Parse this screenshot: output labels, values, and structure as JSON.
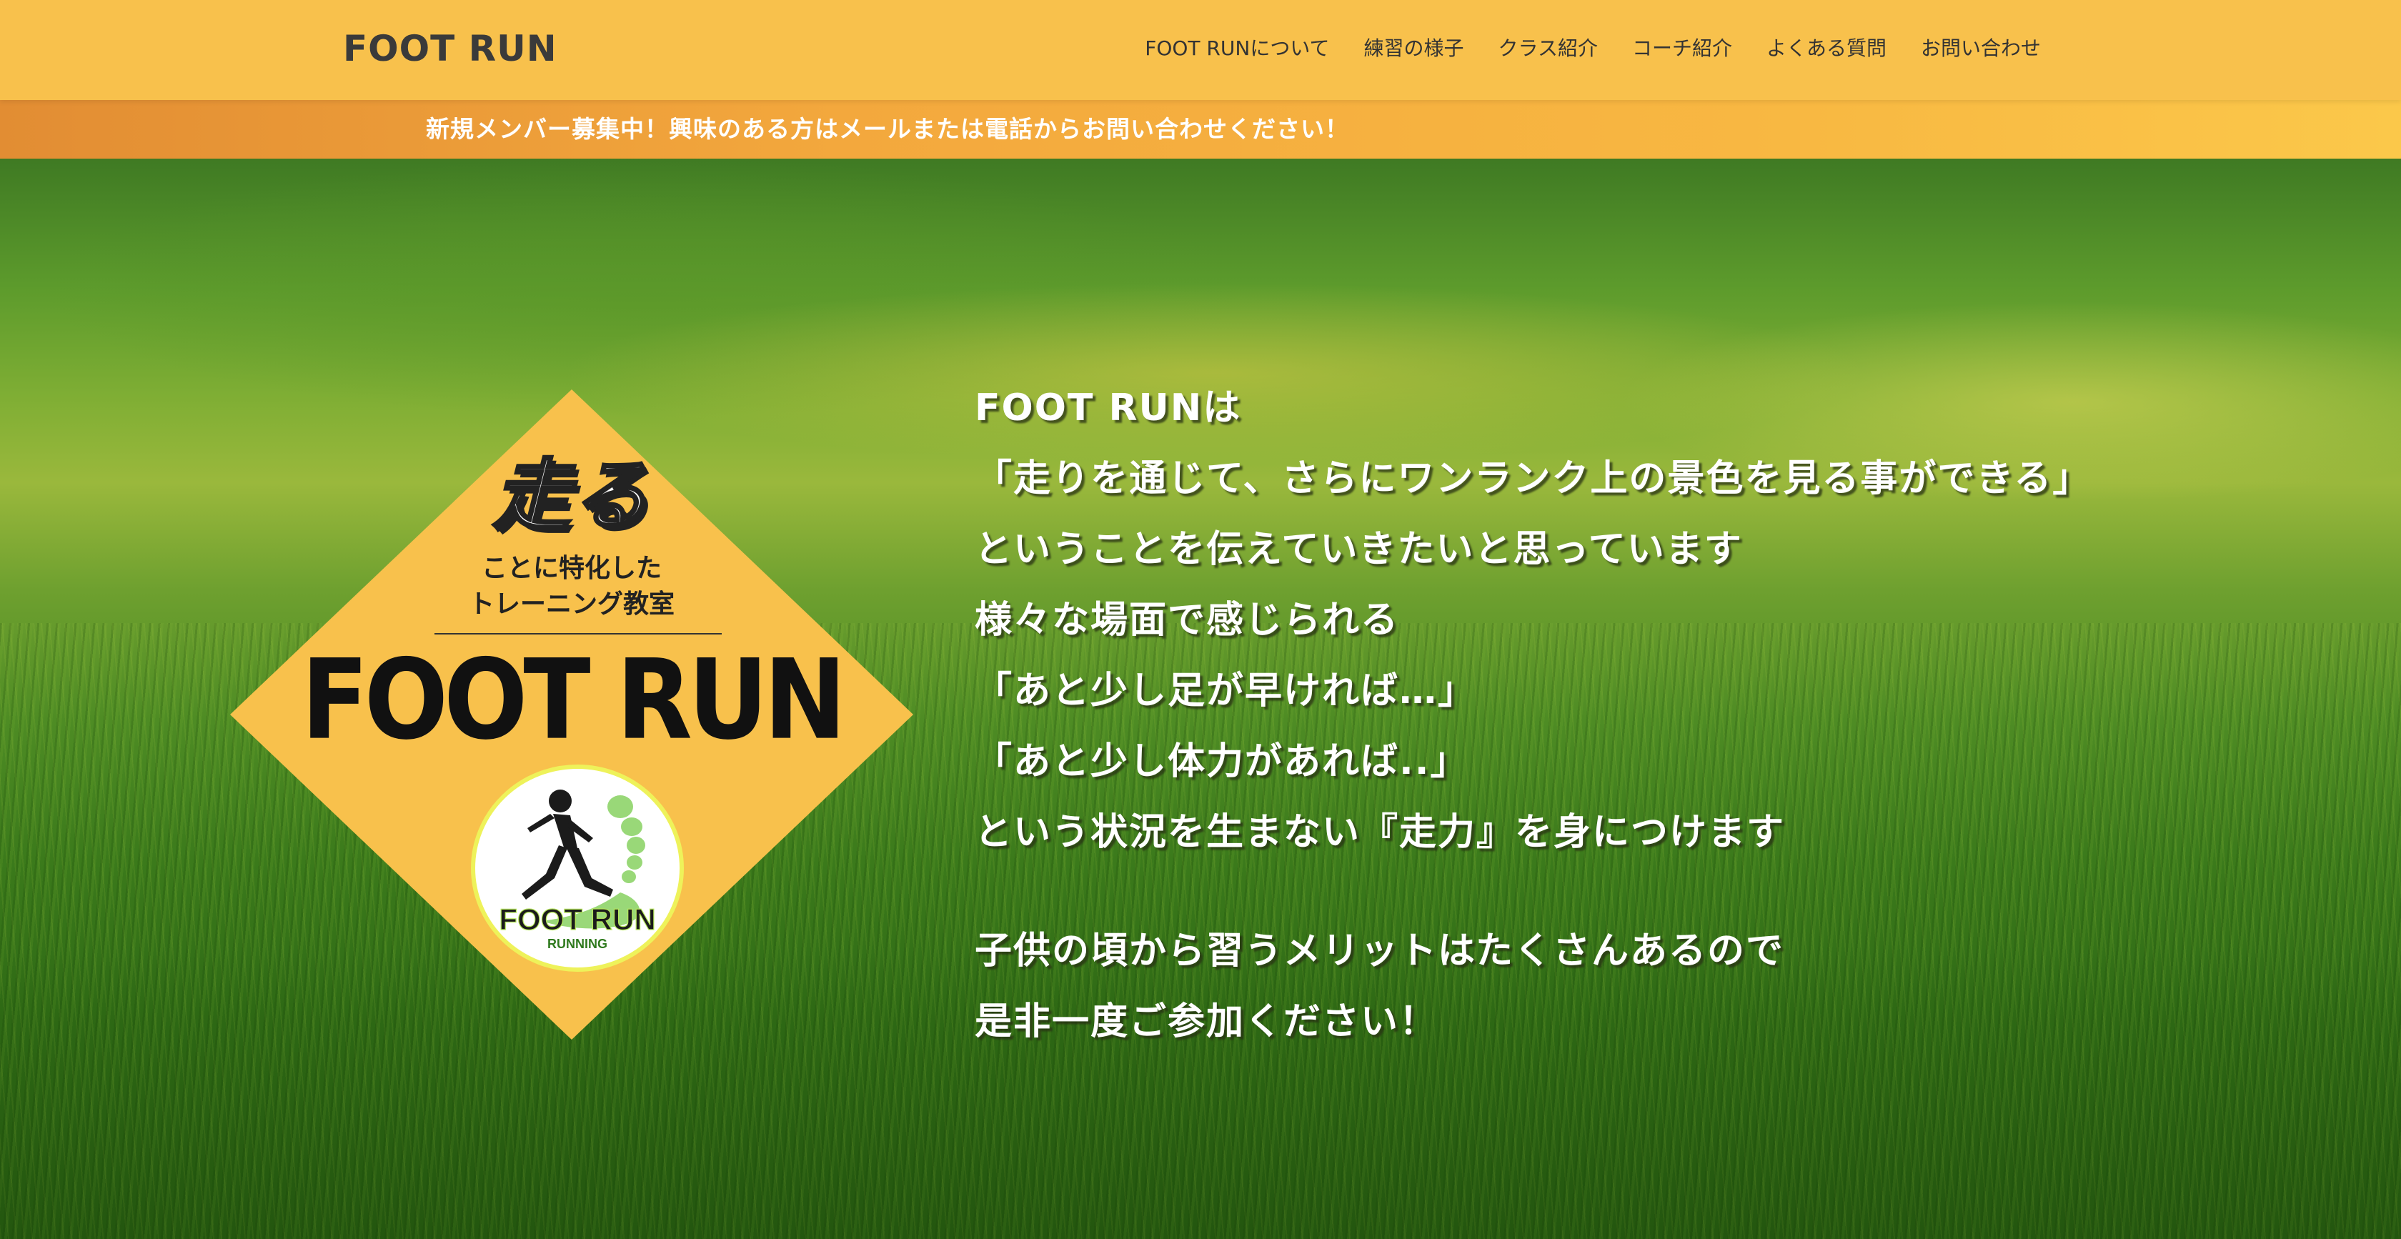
{
  "header": {
    "site_title": "FOOT RUN",
    "nav": [
      {
        "label": "FOOT RUNについて"
      },
      {
        "label": "練習の様子"
      },
      {
        "label": "クラス紹介"
      },
      {
        "label": "コーチ紹介"
      },
      {
        "label": "よくある質問"
      },
      {
        "label": "お問い合わせ"
      }
    ]
  },
  "notice": {
    "text": "新規メンバー募集中！興味のある方はメールまたは電話からお問い合わせください！"
  },
  "hero": {
    "logo": {
      "headline": "走る",
      "tagline_line1": "ことに特化した",
      "tagline_line2": "トレーニング教室",
      "brand": "FOOT RUN",
      "emblem_brand": "FOOT RUN",
      "emblem_sub": "RUNNING"
    },
    "intro_lines": [
      "FOOT RUNは",
      "「走りを通じて、さらにワンランク上の景色を見る事ができる」",
      "ということを伝えていきたいと思っています",
      "様々な場面で感じられる",
      "「あと少し足が早ければ…」",
      "「あと少し体力があれば..」",
      "という状況を生まない『走力』を身につけます"
    ],
    "closing_lines": [
      "子供の頃から習うメリットはたくさんあるので",
      "是非一度ご参加ください！"
    ]
  },
  "colors": {
    "header_bg": "#f8c14c",
    "notice_start": "#e28d33",
    "notice_end": "#fbc84a",
    "diamond": "#f8c14c",
    "emblem_ring": "#eef25a",
    "emblem_green": "#8fd46a"
  }
}
